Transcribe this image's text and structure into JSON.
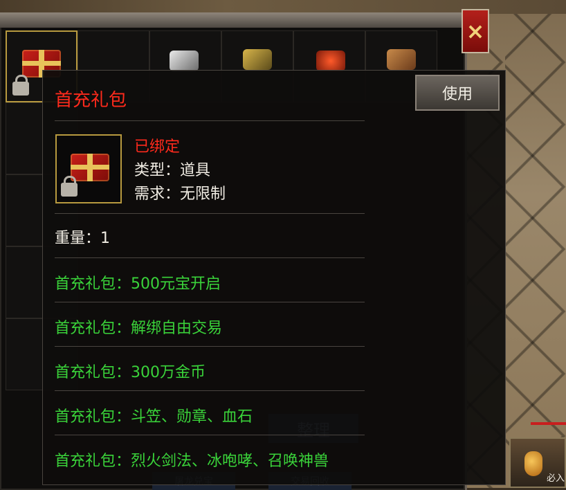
{
  "tooltip": {
    "title": "首充礼包",
    "use_button": "使用",
    "bind_status": "已绑定",
    "type_line": "类型：道具",
    "requirement_line": "需求：无限制",
    "weight_line": "重量：1",
    "contents": [
      "首充礼包：500元宝开启",
      "首充礼包：解绑自由交易",
      "首充礼包：300万金币",
      "首充礼包：斗笠、勋章、血石",
      "首充礼包：烈火剑法、冰咆哮、召唤神兽"
    ]
  },
  "inventory": {
    "close_icon": "×",
    "sort_button": "整理",
    "bottom_buttons": [
      "屠龙兑宝",
      "交易回收"
    ]
  },
  "hud": {
    "potion_label": "必入"
  },
  "colors": {
    "title_red": "#ff2a1c",
    "content_green": "#3ad33a",
    "text_white": "#f1ede4"
  }
}
